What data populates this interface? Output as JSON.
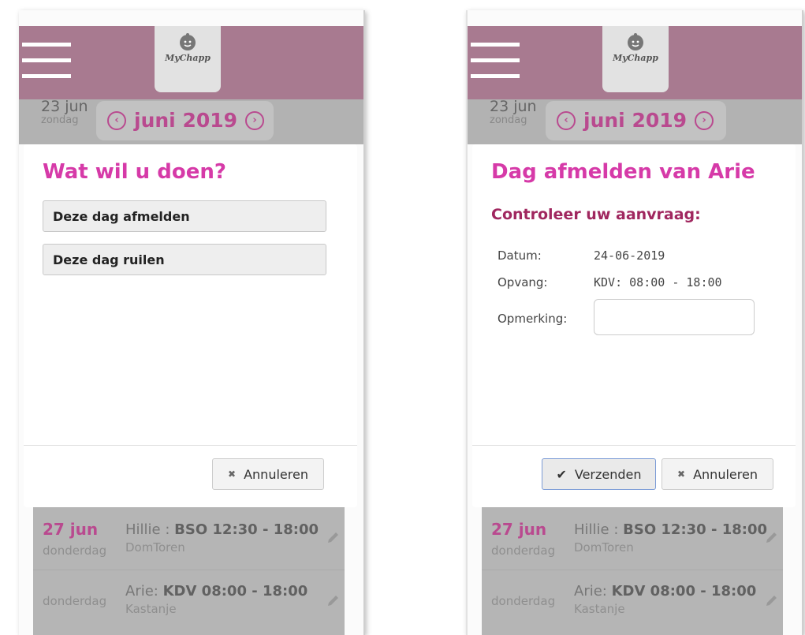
{
  "app": {
    "logo_text": "MyChapp"
  },
  "header": {
    "date_day": "23 jun",
    "date_weekday": "zondag",
    "month_label": "juni 2019"
  },
  "left_screen": {
    "modal_title": "Wat wil u doen?",
    "actions": [
      "Deze dag afmelden",
      "Deze dag ruilen"
    ],
    "cancel_label": "Annuleren"
  },
  "right_screen": {
    "modal_title": "Dag afmelden van Arie",
    "subtitle": "Controleer uw aanvraag:",
    "fields": {
      "datum_label": "Datum:",
      "datum_value": "24-06-2019",
      "opvang_label": "Opvang:",
      "opvang_value": "KDV: 08:00 - 18:00",
      "opmerking_label": "Opmerking:",
      "opmerking_value": ""
    },
    "send_label": "Verzenden",
    "cancel_label": "Annuleren"
  },
  "list": {
    "rows": [
      {
        "date": "27 jun",
        "weekday": "donderdag",
        "name": "Hillie :",
        "slot": "BSO 12:30 - 18:00",
        "location": "DomToren"
      },
      {
        "date": "",
        "weekday": "donderdag",
        "name": "Arie:",
        "slot": "KDV 08:00 - 18:00",
        "location": "Kastanje"
      }
    ]
  },
  "colors": {
    "brand": "#a87a90",
    "accent_pink": "#d63aa8",
    "accent_dark": "#a0275f"
  },
  "icons": [
    "menu-icon",
    "baby-face-icon",
    "chevron-left-icon",
    "chevron-right-icon",
    "close-icon",
    "check-icon",
    "pencil-icon"
  ]
}
